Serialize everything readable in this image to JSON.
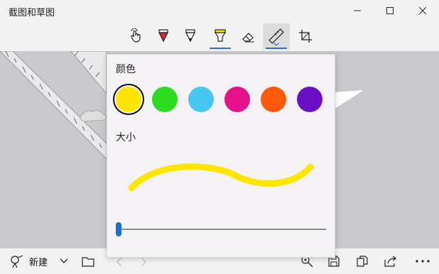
{
  "window": {
    "title": "截图和草图",
    "min_icon": "minimize-icon",
    "max_icon": "maximize-icon",
    "close_icon": "close-icon"
  },
  "toolbar": {
    "tools": [
      {
        "name": "touch-writing-icon"
      },
      {
        "name": "ballpoint-pen-icon",
        "color": "#e0202a"
      },
      {
        "name": "pencil-icon",
        "color": "#111111"
      },
      {
        "name": "highlighter-icon",
        "color": "#ffe600"
      },
      {
        "name": "eraser-icon"
      },
      {
        "name": "ruler-icon"
      },
      {
        "name": "crop-icon"
      }
    ]
  },
  "popup": {
    "color_heading": "颜色",
    "size_heading": "大小",
    "colors": [
      "#ffe600",
      "#2bdc1f",
      "#47c6f2",
      "#e5108c",
      "#ff5a0a",
      "#6c10c8"
    ],
    "selected_color_index": 0,
    "size_fraction": 0.0,
    "accent": "#1a6fc7"
  },
  "bottombar": {
    "new_label": "新建",
    "icons": [
      "new-snip-icon",
      "dropdown-chevron-icon",
      "open-folder-icon",
      "undo-icon",
      "redo-icon",
      "zoom-icon",
      "save-icon",
      "copy-icon",
      "share-icon",
      "more-icon"
    ]
  }
}
